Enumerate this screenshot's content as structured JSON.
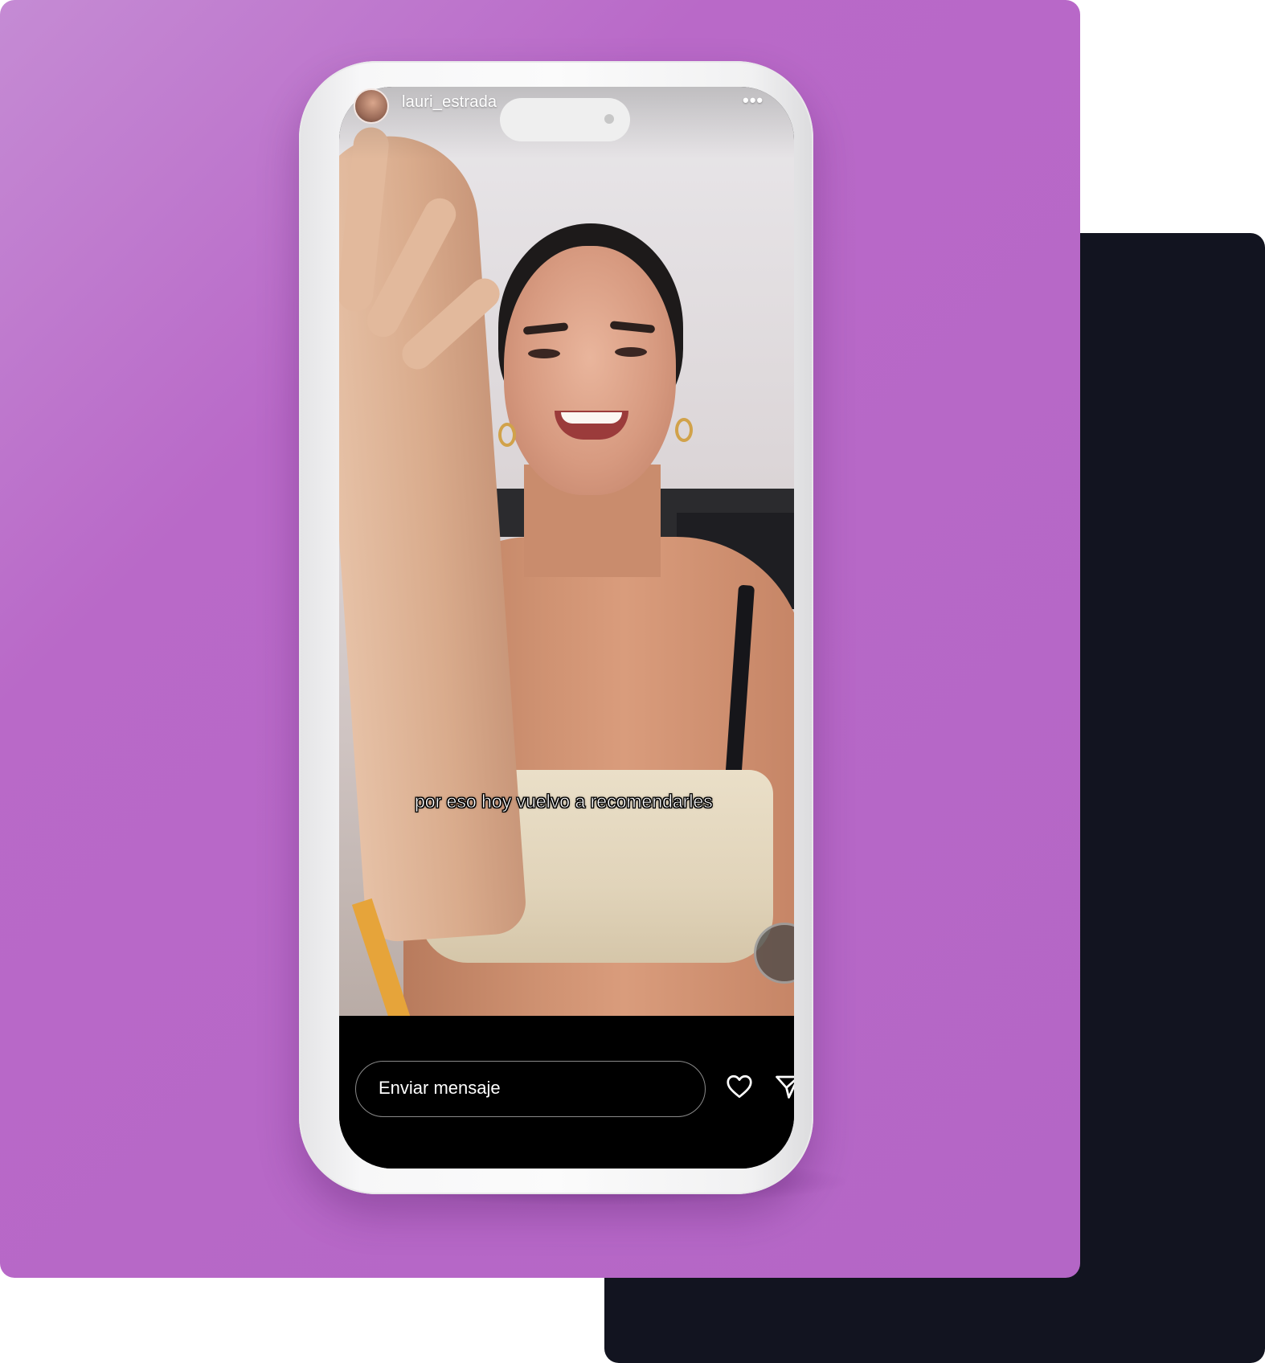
{
  "story": {
    "username": "lauri_estrada",
    "more_icon": "ellipsis-icon",
    "caption": "por eso hoy vuelvo a recomendarles"
  },
  "reply_bar": {
    "message_placeholder": "Enviar mensaje",
    "like_icon": "heart-icon",
    "share_icon": "send-icon"
  },
  "colors": {
    "background_card": "#b466c6",
    "dark_panel": "#121420",
    "phone_frame": "#f5f5f6",
    "reply_bar_bg": "#000000",
    "text": "#ffffff"
  }
}
